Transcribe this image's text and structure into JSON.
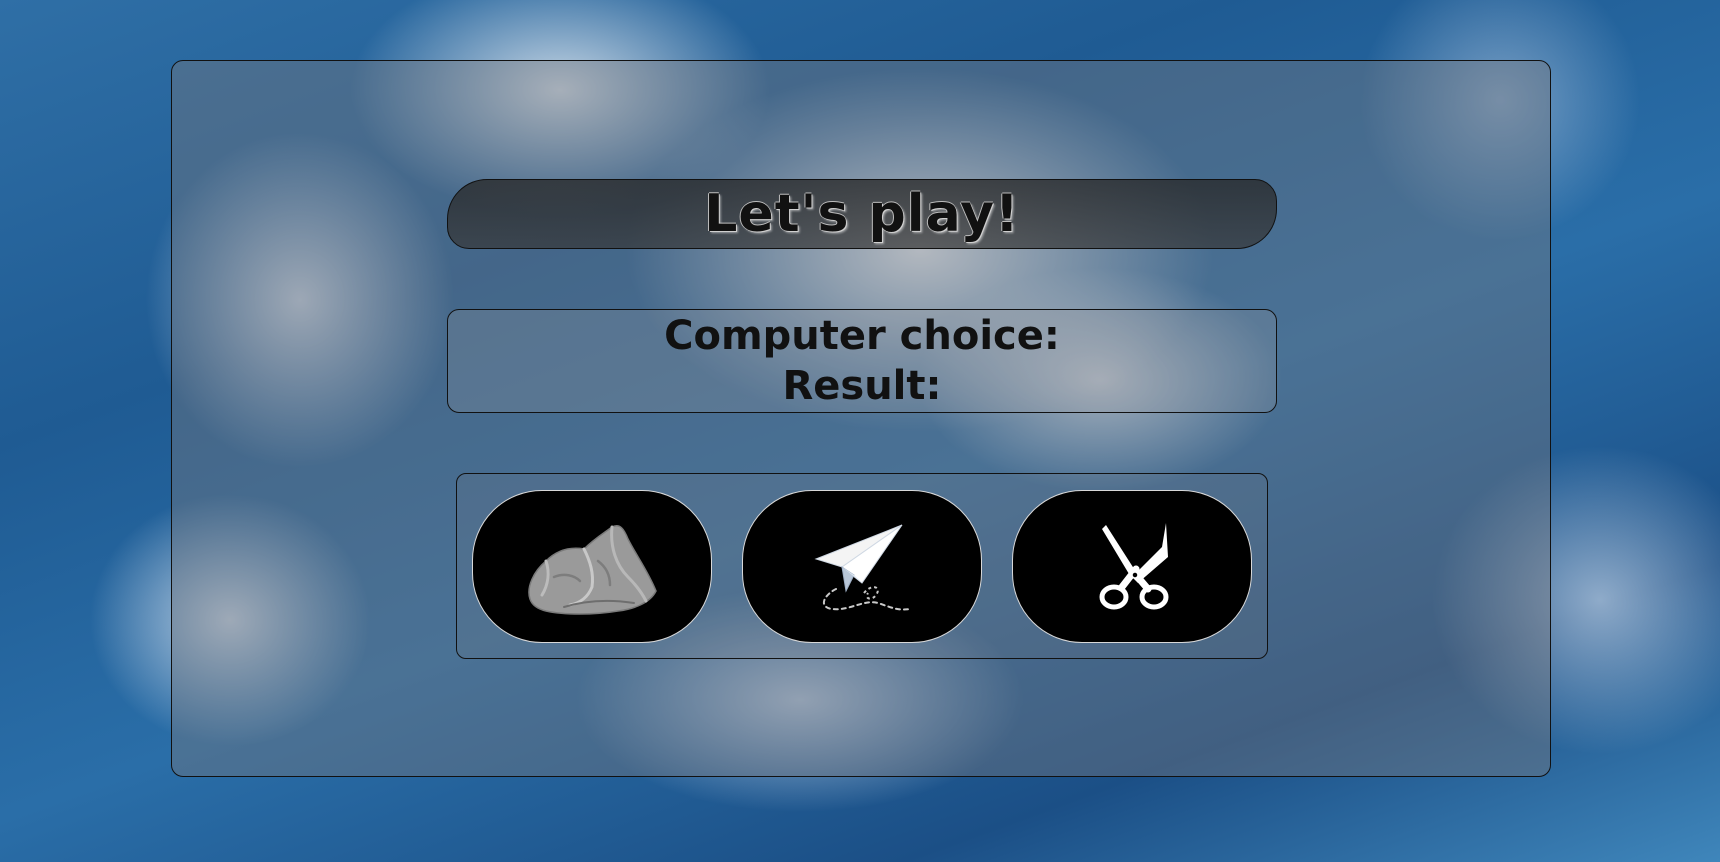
{
  "game": {
    "title": "Let's play!",
    "computer_choice_label": "Computer choice:",
    "result_label": "Result:"
  },
  "choices": [
    {
      "name": "rock",
      "icon": "rock-icon"
    },
    {
      "name": "paper",
      "icon": "paper-plane-icon"
    },
    {
      "name": "scissors",
      "icon": "scissors-icon"
    }
  ],
  "colors": {
    "button_bg": "#000000",
    "text": "#111111"
  }
}
